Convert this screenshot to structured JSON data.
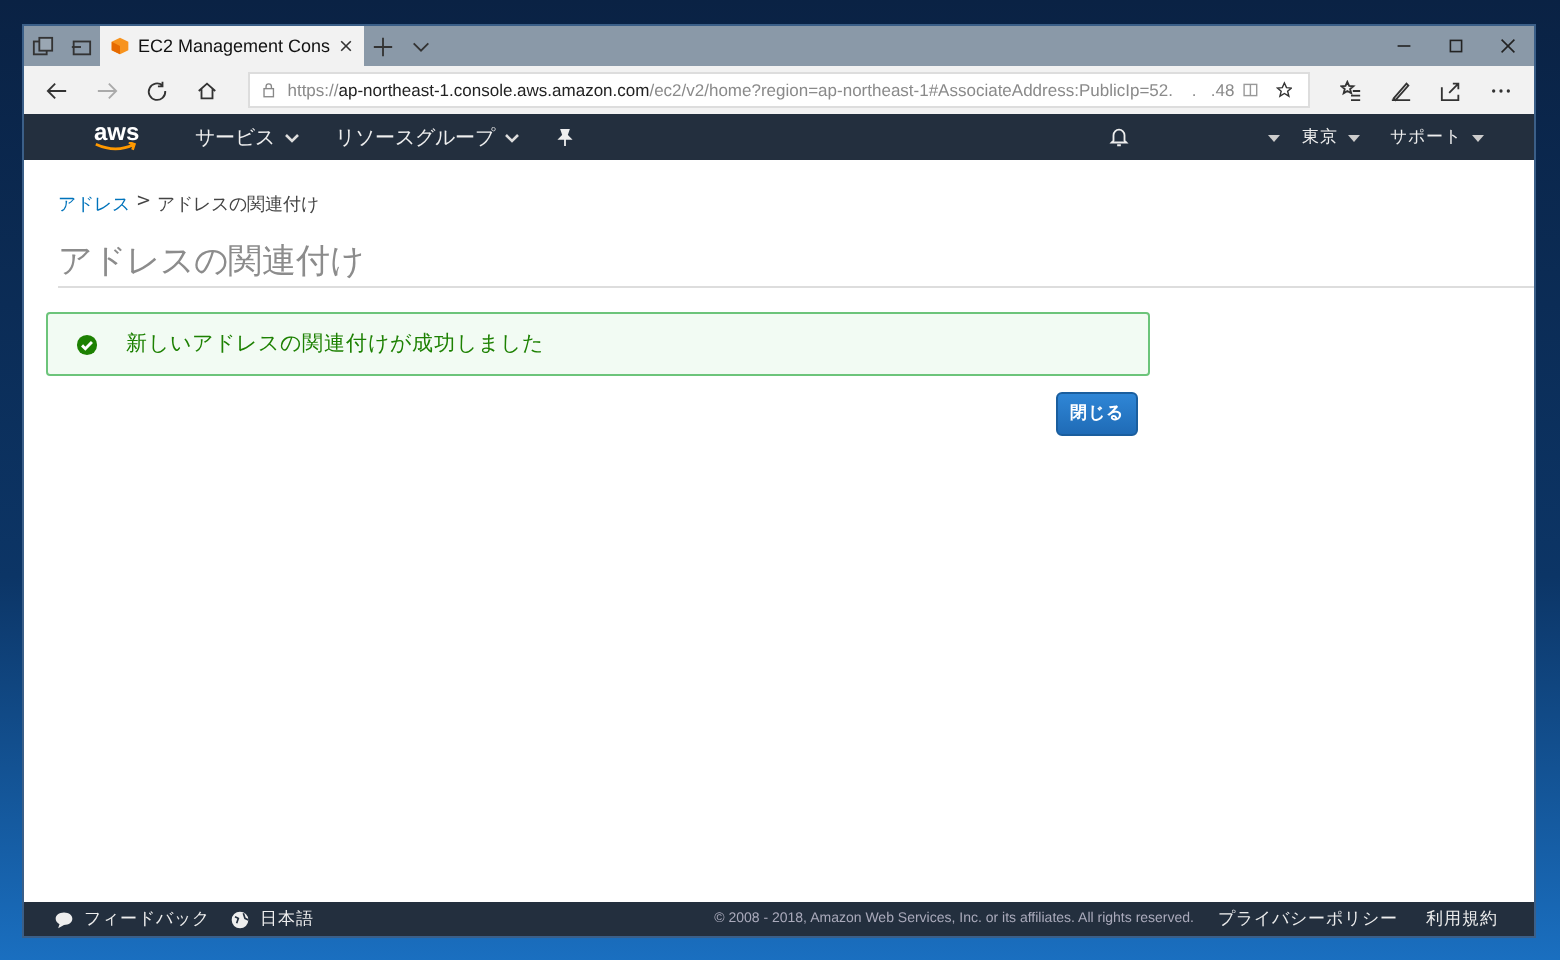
{
  "browser": {
    "tab": {
      "title": "EC2 Management Cons",
      "selected": true
    },
    "address": {
      "scheme": "https://",
      "host": "ap-northeast-1.console.aws.amazon.com",
      "path": "/ec2/v2/home?region=ap-northeast-1#AssociateAddress:PublicIp=52.    .   .48"
    }
  },
  "nav": {
    "logo": "aws",
    "menus": [
      {
        "label": "サービス"
      },
      {
        "label": "リソースグループ"
      }
    ],
    "region": "東京",
    "support": "サポート"
  },
  "breadcrumb": {
    "link": "アドレス",
    "separator": ">",
    "current": "アドレスの関連付け"
  },
  "title": "アドレスの関連付け",
  "alert": {
    "kind": "success",
    "message": "新しいアドレスの関連付けが成功しました"
  },
  "buttons": [
    "閉じる"
  ],
  "footer": {
    "feedback": "フィードバック",
    "language": "日本語",
    "copyright": "© 2008 - 2018, Amazon Web Services, Inc. or its affiliates. All rights reserved.",
    "links": [
      "プライバシーポリシー",
      "利用規約"
    ]
  }
}
